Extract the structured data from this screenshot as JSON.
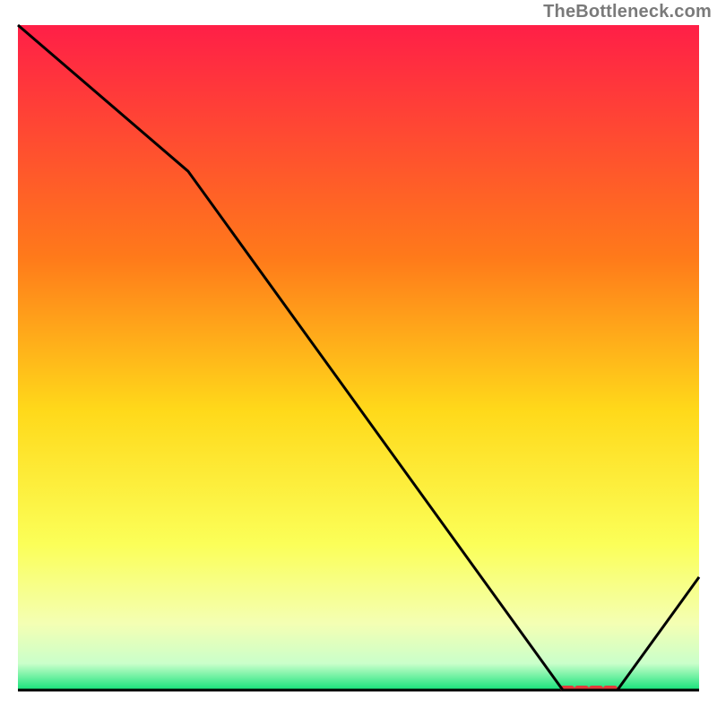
{
  "watermark": "TheBottleneck.com",
  "colors": {
    "grad_top": "#ff1f47",
    "grad_mid1": "#ff7a1a",
    "grad_mid2": "#ffd91a",
    "grad_mid3": "#fbff58",
    "grad_mid4": "#f4ffb3",
    "grad_mid5": "#caffca",
    "grad_bottom": "#14e27a",
    "curve": "#000000",
    "marker": "#e23b3b"
  },
  "chart_data": {
    "type": "line",
    "title": "",
    "xlabel": "",
    "ylabel": "",
    "xlim": [
      0,
      100
    ],
    "ylim": [
      0,
      100
    ],
    "x": [
      0,
      25,
      80,
      88,
      100
    ],
    "values": [
      100,
      78,
      0,
      0,
      17
    ],
    "minimum_marker": {
      "x_start": 80,
      "x_end": 88,
      "y": 0
    },
    "annotations": []
  }
}
